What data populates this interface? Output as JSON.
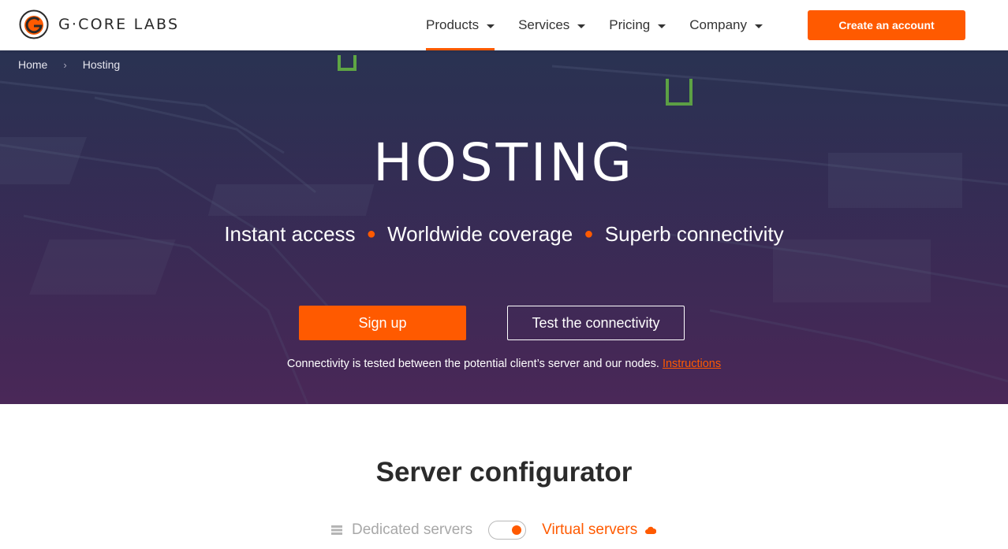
{
  "brand": {
    "name": "G·CORE LABS",
    "accent": "#ff5a00"
  },
  "nav": {
    "items": [
      {
        "label": "Products",
        "active": true
      },
      {
        "label": "Services",
        "active": false
      },
      {
        "label": "Pricing",
        "active": false
      },
      {
        "label": "Company",
        "active": false
      }
    ],
    "cta_label": "Create an account"
  },
  "breadcrumb": {
    "home": "Home",
    "current": "Hosting"
  },
  "hero": {
    "title": "HOSTING",
    "taglines": [
      "Instant access",
      "Worldwide coverage",
      "Superb connectivity"
    ],
    "signup_label": "Sign up",
    "test_label": "Test the connectivity",
    "note": "Connectivity is tested between the potential client’s server and our nodes.",
    "note_link": "Instructions"
  },
  "configurator": {
    "title": "Server configurator",
    "option_off": "Dedicated servers",
    "option_on": "Virtual servers",
    "icons": [
      "server-icon",
      "cloud-icon"
    ]
  }
}
